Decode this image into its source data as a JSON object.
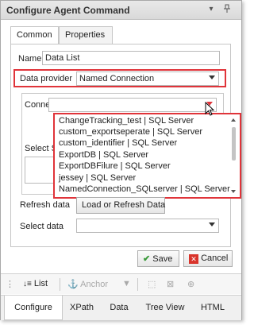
{
  "window": {
    "title": "Configure Agent Command"
  },
  "tabs": [
    {
      "label": "Common"
    },
    {
      "label": "Properties"
    }
  ],
  "form": {
    "name_label": "Name",
    "name_value": "Data List",
    "provider_label": "Data provider",
    "provider_value": "Named Connection",
    "connection_label": "Connection",
    "select_label": "Select S",
    "refresh_label": "Refresh data",
    "refresh_button": "Load or Refresh Data",
    "select_data_label": "Select data",
    "select_data_value": ""
  },
  "connection_list": [
    "ChangeTracking_test | SQL Server",
    "custom_exportseperate | SQL Server",
    "custom_identifier | SQL Server",
    "ExportDB | SQL Server",
    "ExportDBFilure | SQL Server",
    "jessey | SQL Server",
    "NamedConnection_SQLserver | SQL Server"
  ],
  "actions": {
    "save": "Save",
    "cancel": "Cancel"
  },
  "toolbar": {
    "list": "List",
    "anchor": "Anchor"
  },
  "bottom_tabs": [
    "Configure",
    "XPath",
    "Data",
    "Tree View",
    "HTML"
  ],
  "colors": {
    "highlight": "#e0343a",
    "save_icon": "#3a9a3a",
    "cancel_icon": "#d9342b"
  }
}
